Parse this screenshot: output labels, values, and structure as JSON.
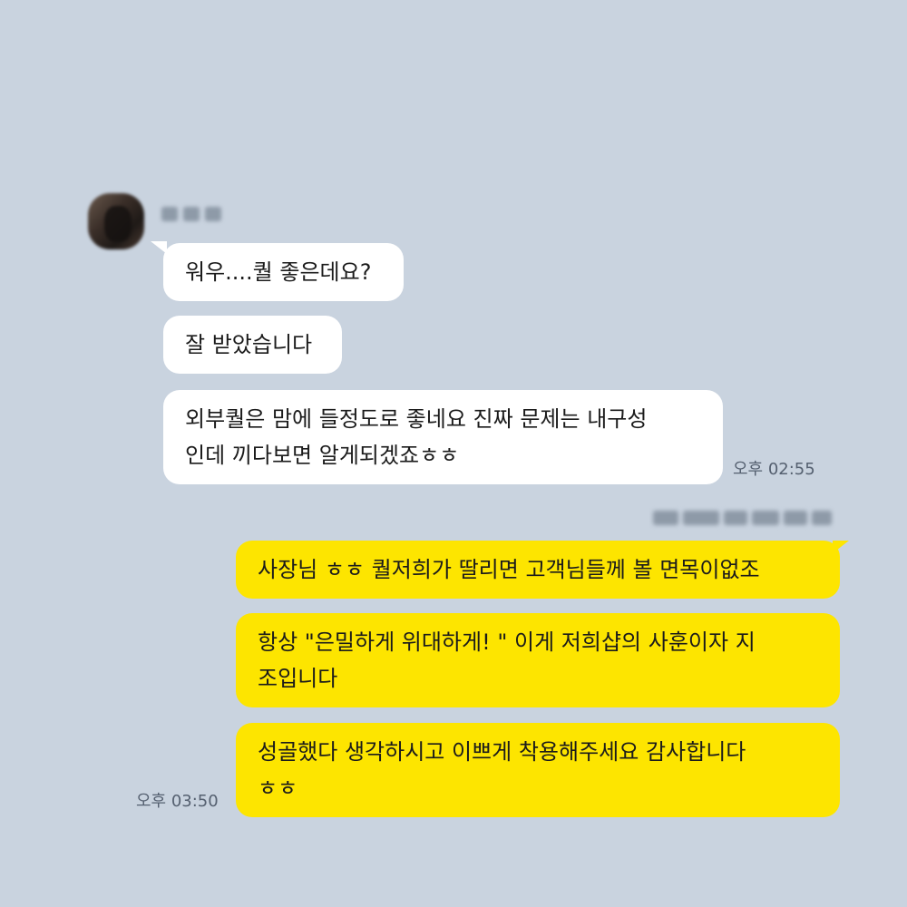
{
  "incoming": {
    "messages": [
      "워우....퀄 좋은데요?",
      "잘 받았습니다",
      "외부퀄은 맘에 들정도로 좋네요 진짜 문제는 내구성\n인데 끼다보면 알게되겠죠ㅎㅎ"
    ],
    "time": "오후 02:55"
  },
  "outgoing": {
    "messages": [
      "사장님 ㅎㅎ 퀄저희가 딸리면 고객님들께 볼 면목이없조",
      "항상 \"은밀하게 위대하게! \" 이게 저희샵의 사훈이자 지\n조입니다",
      "성골했다 생각하시고 이쁘게 착용해주세요 감사합니다\nㅎㅎ"
    ],
    "time": "오후 03:50"
  }
}
